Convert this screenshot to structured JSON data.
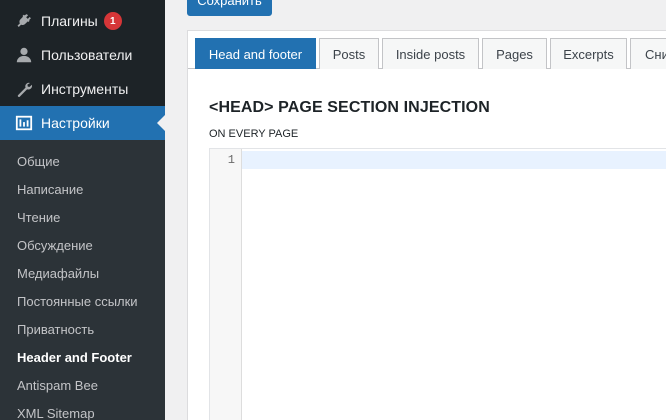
{
  "sidebar": {
    "menu": [
      {
        "label": "Плагины",
        "icon": "plugin-icon",
        "badge": "1"
      },
      {
        "label": "Пользователи",
        "icon": "user-icon"
      },
      {
        "label": "Инструменты",
        "icon": "wrench-icon"
      },
      {
        "label": "Настройки",
        "icon": "settings-icon",
        "active": true
      }
    ],
    "submenu": [
      {
        "label": "Общие"
      },
      {
        "label": "Написание"
      },
      {
        "label": "Чтение"
      },
      {
        "label": "Обсуждение"
      },
      {
        "label": "Медиафайлы"
      },
      {
        "label": "Постоянные ссылки"
      },
      {
        "label": "Приватность"
      },
      {
        "label": "Header and Footer",
        "current": true
      },
      {
        "label": "Antispam Bee"
      },
      {
        "label": "XML Sitemap"
      }
    ]
  },
  "toolbar": {
    "save_label": "Сохранить"
  },
  "tabs": [
    {
      "label": "Head and footer",
      "active": true
    },
    {
      "label": "Posts"
    },
    {
      "label": "Inside posts"
    },
    {
      "label": "Pages"
    },
    {
      "label": "Excerpts"
    },
    {
      "label": "Сни"
    }
  ],
  "section": {
    "title": "<HEAD> PAGE SECTION INJECTION",
    "label": "ON EVERY PAGE"
  },
  "editor": {
    "line_number": "1",
    "content": ""
  },
  "colors": {
    "accent": "#2271b1",
    "sidebar_bg": "#1d2327",
    "submenu_bg": "#2c3338",
    "badge": "#d63638"
  }
}
